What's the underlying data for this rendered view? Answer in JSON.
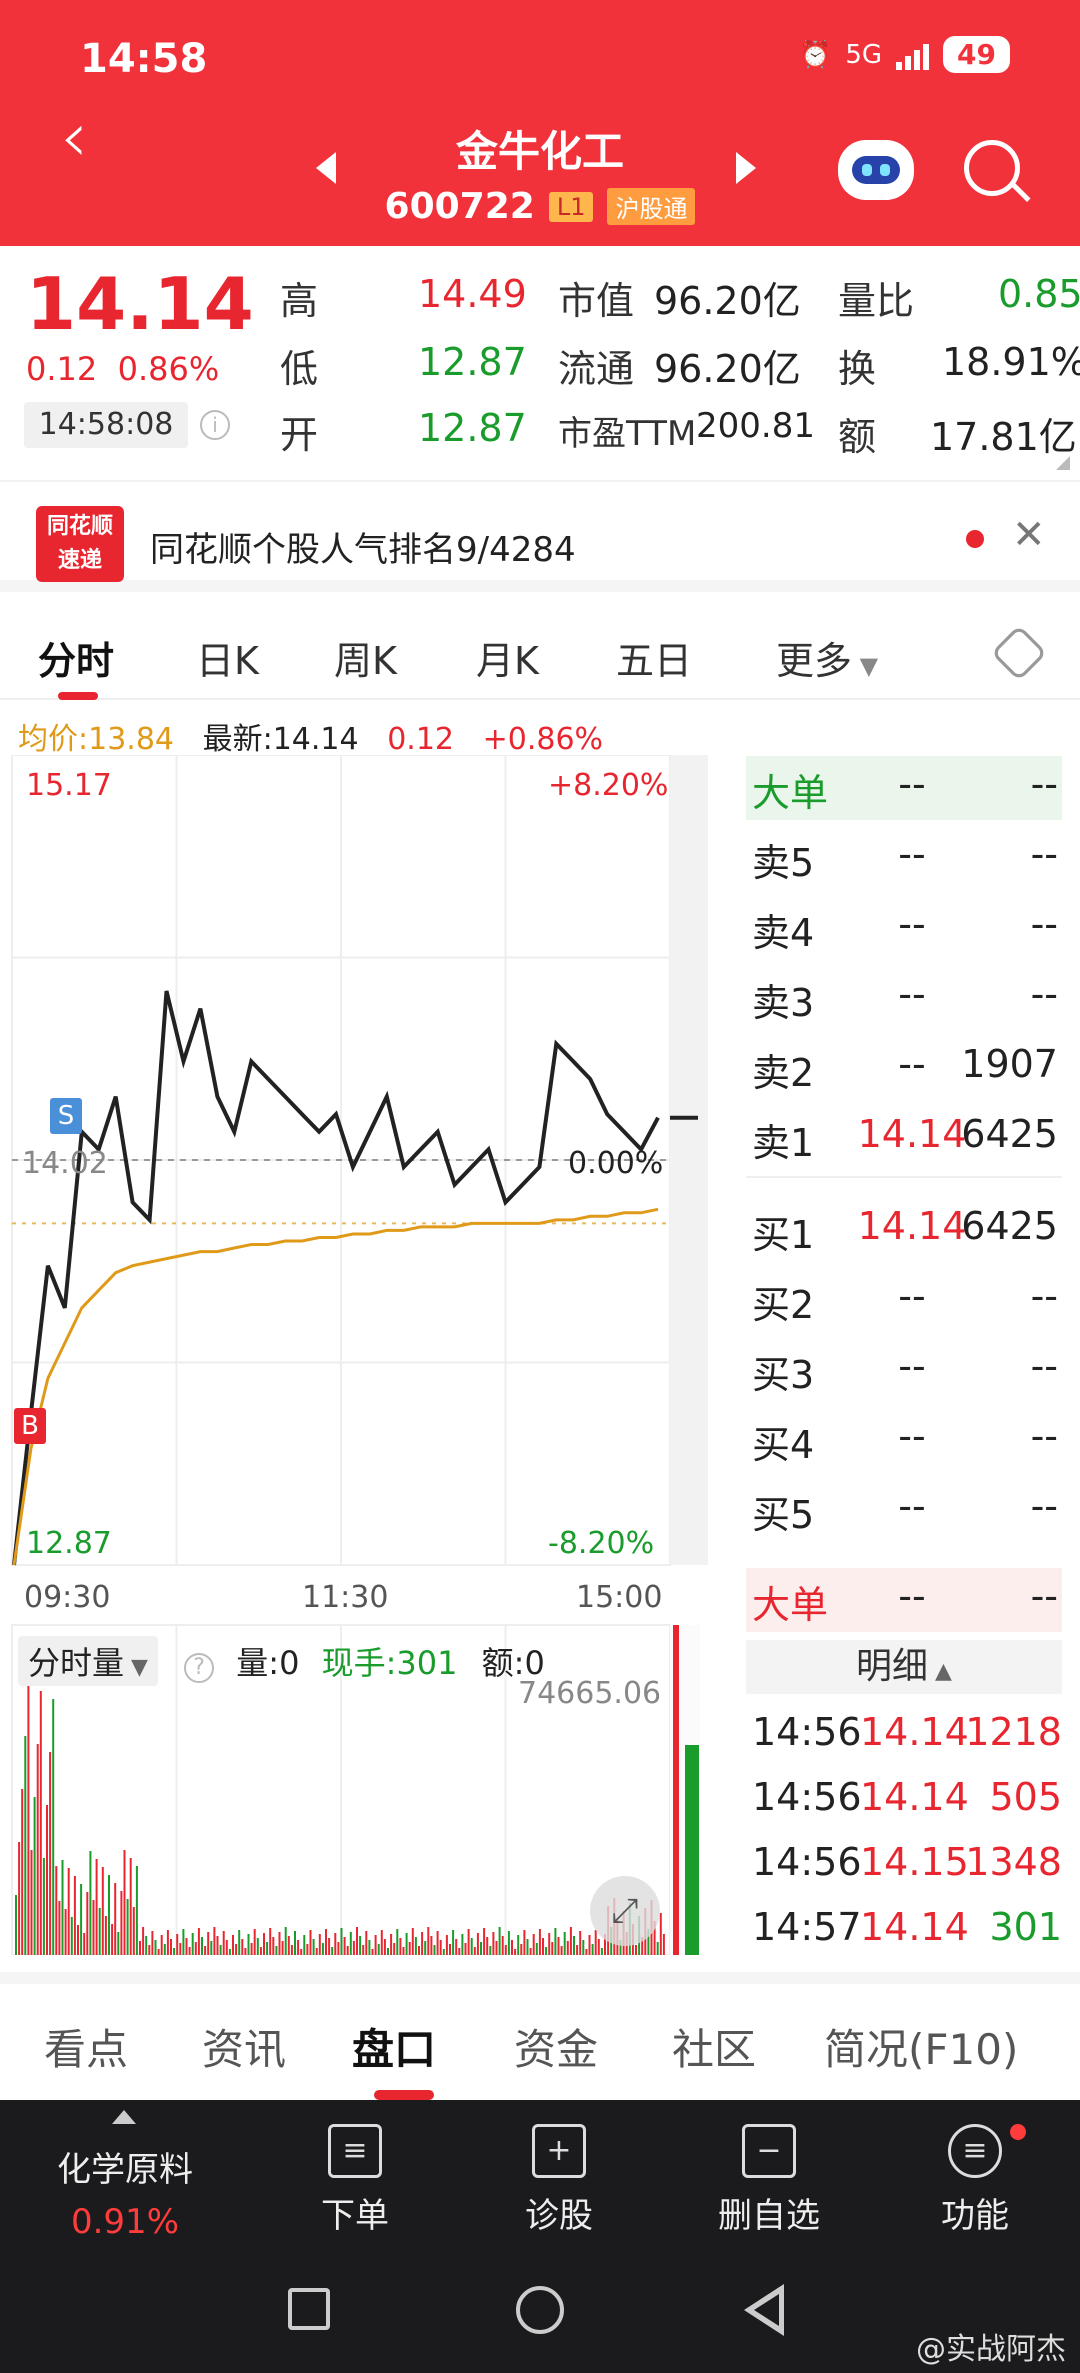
{
  "status_bar": {
    "time": "14:58",
    "battery": "49",
    "network": "5G"
  },
  "header": {
    "title": "金牛化工",
    "code": "600722",
    "level_tag": "L1",
    "connect_tag": "沪股通"
  },
  "quote": {
    "price": "14.14",
    "change": "0.12",
    "change_pct": "0.86%",
    "time": "14:58:08",
    "high_label": "高",
    "high": "14.49",
    "low_label": "低",
    "low": "12.87",
    "open_label": "开",
    "open": "12.87",
    "mcap_label": "市值",
    "mcap": "96.20亿",
    "float_label": "流通",
    "float": "96.20亿",
    "pe_label": "市盈TTM",
    "pe": "200.81",
    "vr_label": "量比",
    "vr": "0.85",
    "turn_label": "换",
    "turn": "18.91%",
    "amt_label": "额",
    "amt": "17.81亿"
  },
  "news": {
    "logo_top": "同花顺",
    "logo_bottom": "速递",
    "text": "同花顺个股人气排名9/4284"
  },
  "tabs": [
    "分时",
    "日K",
    "周K",
    "月K",
    "五日",
    "更多"
  ],
  "info_row": {
    "avg_label": "均价:",
    "avg": "13.84",
    "latest_label": "最新:",
    "latest": "14.14",
    "change": "0.12",
    "change_pct": "+0.86%"
  },
  "chart_labels": {
    "y_top": "15.17",
    "y_mid": "14.02",
    "y_bottom": "12.87",
    "pct_top": "+8.20%",
    "pct_mid": "0.00%",
    "pct_bottom": "-8.20%",
    "x_start": "09:30",
    "x_mid": "11:30",
    "x_end": "15:00",
    "marker_s": "S",
    "marker_b": "B"
  },
  "chart_data": {
    "type": "line",
    "ylim": [
      12.87,
      15.17
    ],
    "x_ticks": [
      "09:30",
      "11:30",
      "15:00"
    ],
    "series": [
      {
        "values": [
          12.87,
          13.3,
          13.72,
          13.6,
          14.1,
          14.05,
          14.2,
          13.9,
          13.85,
          14.5,
          14.3,
          14.45,
          14.2,
          14.1,
          14.3,
          14.25,
          14.2,
          14.15,
          14.1,
          14.15,
          14.0,
          14.1,
          14.2,
          14.0,
          14.05,
          14.1,
          13.95,
          14.0,
          14.05,
          13.9,
          13.95,
          14.0,
          14.35,
          14.3,
          14.25,
          14.15,
          14.1,
          14.05,
          14.14
        ]
      },
      {
        "values": [
          12.87,
          13.2,
          13.4,
          13.5,
          13.6,
          13.65,
          13.7,
          13.72,
          13.73,
          13.74,
          13.75,
          13.76,
          13.76,
          13.77,
          13.78,
          13.78,
          13.79,
          13.79,
          13.8,
          13.8,
          13.81,
          13.81,
          13.82,
          13.82,
          13.83,
          13.83,
          13.83,
          13.84,
          13.84,
          13.84,
          13.84,
          13.84,
          13.85,
          13.85,
          13.86,
          13.86,
          13.87,
          13.87,
          13.88
        ]
      }
    ]
  },
  "order_book": {
    "big_label": "大单",
    "placeholder": "--",
    "asks": [
      {
        "label": "卖5",
        "price": "--",
        "vol": "--"
      },
      {
        "label": "卖4",
        "price": "--",
        "vol": "--"
      },
      {
        "label": "卖3",
        "price": "--",
        "vol": "--"
      },
      {
        "label": "卖2",
        "price": "--",
        "vol": "1907"
      },
      {
        "label": "卖1",
        "price": "14.14",
        "vol": "6425"
      }
    ],
    "bids": [
      {
        "label": "买1",
        "price": "14.14",
        "vol": "6425"
      },
      {
        "label": "买2",
        "price": "--",
        "vol": "--"
      },
      {
        "label": "买3",
        "price": "--",
        "vol": "--"
      },
      {
        "label": "买4",
        "price": "--",
        "vol": "--"
      },
      {
        "label": "买5",
        "price": "--",
        "vol": "--"
      }
    ]
  },
  "volume": {
    "mode": "分时量",
    "vol_label": "量:",
    "vol": "0",
    "hand_label": "现手:",
    "hand": "301",
    "amt_label": "额:",
    "amt": "0",
    "max": "74665.06"
  },
  "detail": {
    "header": "明细",
    "rows": [
      {
        "time": "14:56",
        "price": "14.14",
        "vol": "1218",
        "dir": "red"
      },
      {
        "time": "14:56",
        "price": "14.14",
        "vol": "505",
        "dir": "red"
      },
      {
        "time": "14:56",
        "price": "14.15",
        "vol": "1348",
        "dir": "red"
      },
      {
        "time": "14:57",
        "price": "14.14",
        "vol": "301",
        "dir": "green"
      }
    ]
  },
  "bottom_tabs": [
    "看点",
    "资讯",
    "盘口",
    "资金",
    "社区",
    "简况(F10)"
  ],
  "bottom_bar": {
    "sector": "化学原料",
    "sector_pct": "0.91%",
    "items": [
      "下单",
      "诊股",
      "删自选",
      "功能"
    ]
  },
  "watermark": "@实战阿杰",
  "colors": {
    "brand_red": "#f2323b",
    "up": "#e8262f",
    "down": "#1a9c2c",
    "avg_line": "#e09a1a"
  }
}
